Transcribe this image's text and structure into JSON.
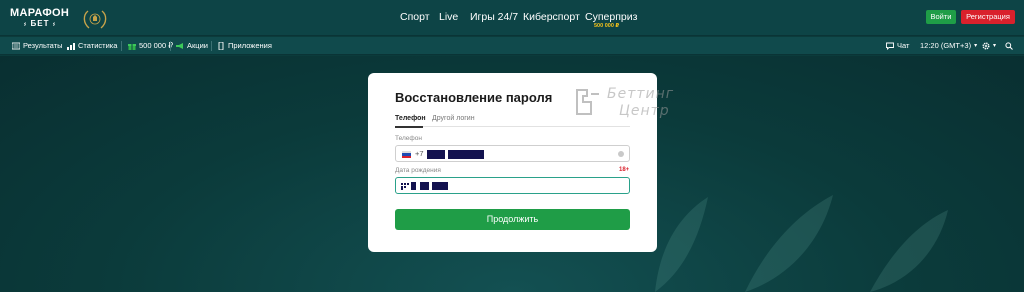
{
  "header": {
    "logo_line1": "МАРАФОН",
    "logo_line2": "БЕТ",
    "nav": [
      {
        "label": "Спорт"
      },
      {
        "label": "Live"
      },
      {
        "label": "Игры 24/7"
      },
      {
        "label": "Киберспорт"
      },
      {
        "label": "Суперприз",
        "sub": "500 000 ₽"
      }
    ],
    "login_label": "Войти",
    "register_label": "Регистрация"
  },
  "subbar": {
    "results": "Результаты",
    "stats": "Статистика",
    "bonus": "500 000 ₽",
    "promos": "Акции",
    "apps": "Приложения",
    "chat": "Чат",
    "time": "12:20 (GMT+3)",
    "time_arrow": "▾",
    "settings_arrow": "▾"
  },
  "modal": {
    "title": "Восстановление пароля",
    "watermark_line1": "Беттинг",
    "watermark_line2": "Центр",
    "tabs": [
      {
        "label": "Телефон",
        "active": true
      },
      {
        "label": "Другой логин",
        "active": false
      }
    ],
    "phone_label": "Телефон",
    "phone_prefix": "+7",
    "dob_label": "Дата рождения",
    "age_badge": "18+",
    "continue_label": "Продолжить"
  },
  "colors": {
    "header_bg": "#0d4446",
    "subbar_bg": "#104a4c",
    "page_bg": "#0b3b3b",
    "login_green": "#1f9d47",
    "register_red": "#d9212c",
    "bonus_gold": "#f4c21a",
    "focus_border": "#2aa18a"
  },
  "icons": {
    "results": "list-icon",
    "stats": "bar-chart-icon",
    "bonus": "gift-icon",
    "promos": "megaphone-icon",
    "apps": "phone-icon",
    "chat": "chat-icon",
    "settings": "gear-icon",
    "search": "search-icon"
  }
}
